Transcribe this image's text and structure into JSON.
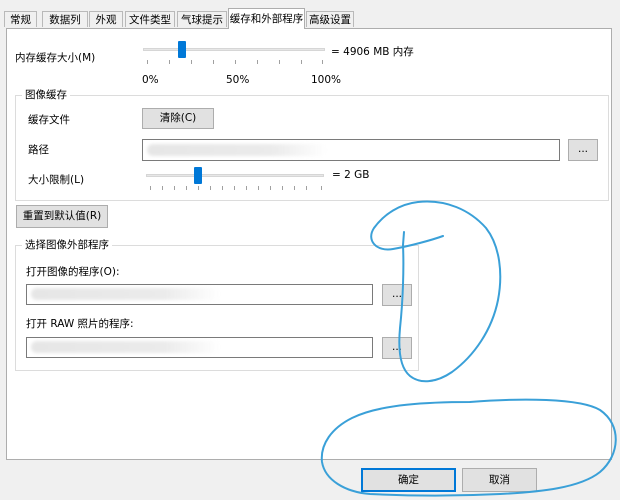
{
  "tabs": [
    "常规",
    "数据列",
    "外观",
    "文件类型",
    "气球提示",
    "缓存和外部程序",
    "高级设置"
  ],
  "memory_cache": {
    "label": "内存缓存大小(M)",
    "value_text": "= 4906 MB 内存",
    "slider_fraction": 0.2,
    "scale_labels": [
      "0%",
      "50%",
      "100%"
    ]
  },
  "image_cache": {
    "group_title": "图像缓存",
    "cache_file_label": "缓存文件",
    "clear_button": "清除(C)",
    "path_label": "路径",
    "browse_button": "...",
    "size_limit_label": "大小限制(L)",
    "size_limit_value": "= 2 GB",
    "size_slider_fraction": 0.28
  },
  "reset_button": "重置到默认值(R)",
  "external_programs": {
    "group_title": "选择图像外部程序",
    "open_image_label": "打开图像的程序(O):",
    "open_raw_label": "打开 RAW 照片的程序:",
    "browse_button": "..."
  },
  "footer": {
    "ok_button": "确定",
    "cancel_button": "取消"
  },
  "colors": {
    "accent": "#0078d7",
    "annotation": "#3aa0d8"
  }
}
